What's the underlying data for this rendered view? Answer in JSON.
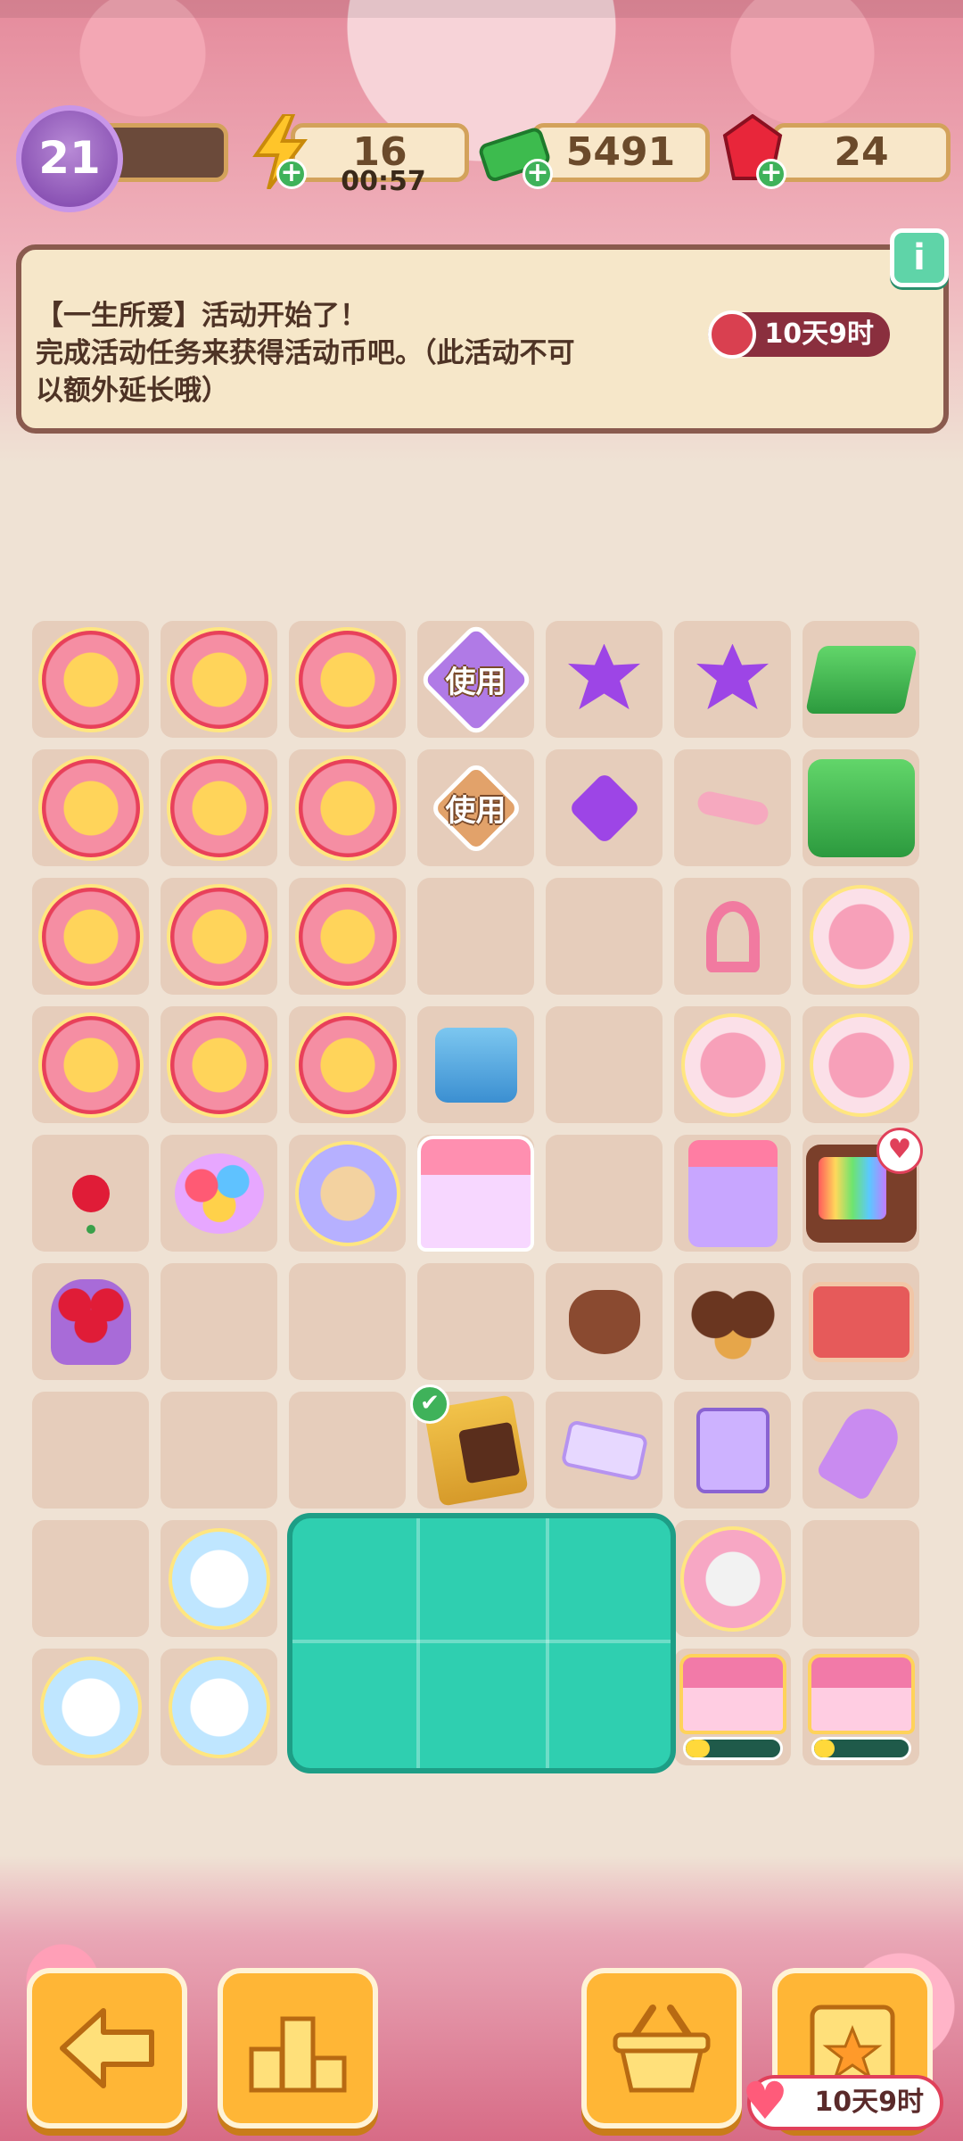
{
  "hud": {
    "level": "21",
    "energy": "16",
    "energy_timer": "00:57",
    "cash": "5491",
    "gems": "24",
    "plus": "+"
  },
  "banner": {
    "line1": "【一生所爱】活动开始了！",
    "line2": "完成活动任务来获得活动币吧。（此活动不可",
    "line3": "以额外延长哦）",
    "timer": "10天9时",
    "info": "i"
  },
  "board": {
    "use_label": "使用",
    "progress": [
      0.25,
      0.22
    ]
  },
  "bottom": {
    "timer": "10天9时"
  },
  "colors": {
    "accent": "#ffb636",
    "banner_bg": "#f6e7c9",
    "teal": "#2fcfb0"
  }
}
